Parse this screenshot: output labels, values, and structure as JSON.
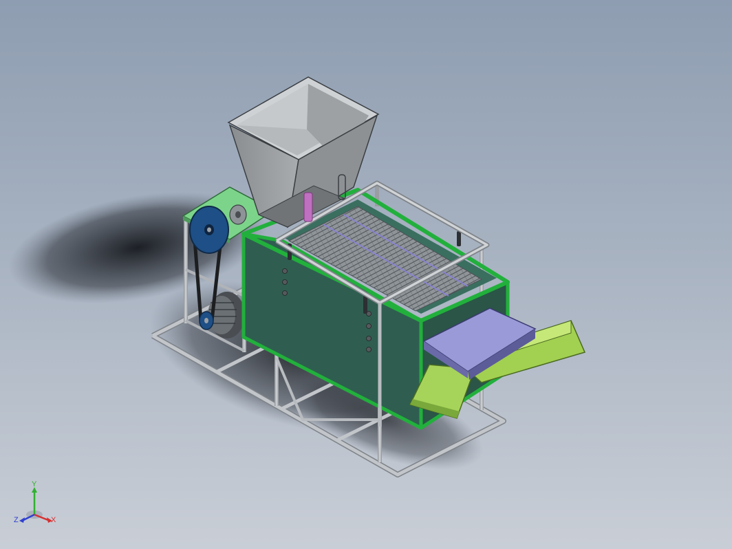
{
  "triad": {
    "x_label": "X",
    "y_label": "Y",
    "z_label": "Z",
    "x_color": "#d83030",
    "y_color": "#30b030",
    "z_color": "#3040d0"
  },
  "colors": {
    "frame": "#b4b8bc",
    "frame_dark": "#7e8388",
    "box_green": "#2f5e50",
    "box_edge": "#22b03c",
    "hopper": "#9ea1a3",
    "hopper_dark": "#6e7275",
    "motor_plate": "#7cd48a",
    "pulley": "#1e4f86",
    "chute_purple": "#9a9ad8",
    "chute_green": "#9ccc50",
    "tab_pink": "#c070c0",
    "shadow": "#1a1d22"
  }
}
